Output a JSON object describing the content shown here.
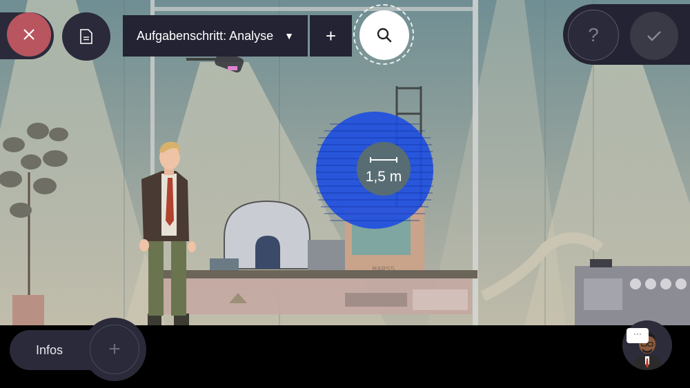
{
  "toolbar": {
    "close_icon": "close-icon",
    "document_icon": "document-icon",
    "step_select_label": "Aufgabenschritt: Analyse",
    "step_caret": "▼",
    "add_label": "+",
    "search_icon": "search-icon"
  },
  "right_controls": {
    "help_label": "?",
    "confirm_icon": "check-icon"
  },
  "scene": {
    "measurement_label": "1,5 m",
    "box_text": "MARS5"
  },
  "bottom": {
    "infos_label": "Infos",
    "plus_label": "+",
    "chat_bubble_text": "···"
  },
  "colors": {
    "close_red": "#b8555f",
    "panel_dark": "#232333",
    "sphere_blue": "#1f4fe0"
  }
}
